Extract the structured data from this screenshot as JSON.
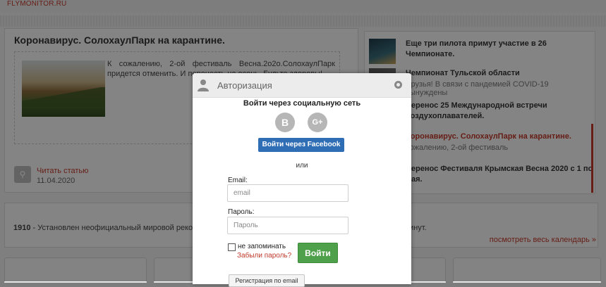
{
  "site": {
    "name": "FLYMONITOR.RU"
  },
  "article": {
    "title": "Коронавирус. СолохаулПарк на карантине.",
    "excerpt": "К сожалению, 2-ой фестиваль Весна.2о2о.СолохаулПарк придется отменить. И перенесть на осень. Будьте здоровы!",
    "read_more": "Читать статью",
    "date": "11.04.2020"
  },
  "news": [
    {
      "title": "Еще три пилота примут участие в 26 Чемпионате.",
      "sub": ""
    },
    {
      "title": "Чемпионат Тульской области",
      "sub": "Друзья! В связи с пандемией COVID-19 вынуждены"
    },
    {
      "title": "Перенос 25 Международной встречи воздухоплавателей.",
      "sub": ""
    },
    {
      "title": "Коронавирус. СолохаулПарк на карантине.",
      "sub": "сожалению, 2-ой фестиваль"
    },
    {
      "title": "Перенос Фестиваля Крымская Весна 2020 с 1 по мая.",
      "sub": ""
    }
  ],
  "calendar": {
    "year": "1910",
    "text": " - Установлен неофициальный мировой рекорд",
    "text_right": "инут.",
    "view_all": "посмотреть весь календарь »"
  },
  "modal": {
    "title": "Авторизация",
    "social_title": "Войти через социальную сеть",
    "vk_letter": "В",
    "gplus_letter": "G+",
    "facebook_button": "Войти через Facebook",
    "or": "или",
    "email_label": "Email:",
    "email_placeholder": "email",
    "password_label": "Пароль:",
    "password_placeholder": "Пароль",
    "remember_label": "не запоминать",
    "forgot_link": "Забыли пароль?",
    "login_button": "Войти",
    "register_button": "Регистрация по email"
  },
  "colors": {
    "accent": "#c0392b",
    "facebook": "#2f6db5",
    "login": "#4fa04a"
  }
}
